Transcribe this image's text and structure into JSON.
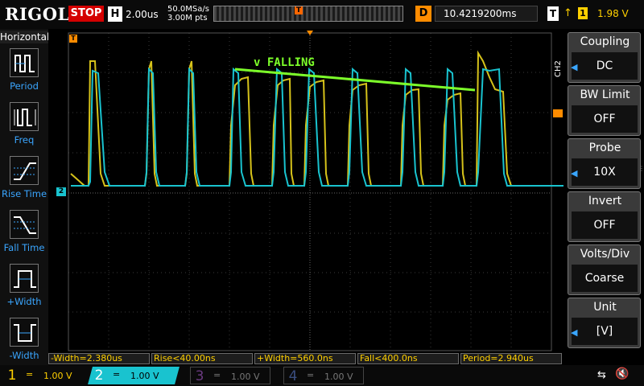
{
  "topbar": {
    "logo": "RIGOL",
    "run_state": "STOP",
    "timebase_label": "H",
    "timebase": "2.00us",
    "sample_rate": "50.0MSa/s",
    "memory_depth": "3.00M pts",
    "trigger_marker": "T",
    "delay_label": "D",
    "delay_value": "10.4219200ms",
    "trigger_label": "T",
    "trigger_edge": "↑",
    "trigger_source": "1",
    "trigger_level": "1.98 V"
  },
  "left_menu": {
    "title": "Horizontal",
    "items": [
      {
        "label": "Period",
        "icon": "period-icon"
      },
      {
        "label": "Freq",
        "icon": "freq-icon"
      },
      {
        "label": "Rise Time",
        "icon": "rise-time-icon"
      },
      {
        "label": "Fall Time",
        "icon": "fall-time-icon"
      },
      {
        "label": "+Width",
        "icon": "pos-width-icon"
      },
      {
        "label": "-Width",
        "icon": "neg-width-icon"
      }
    ]
  },
  "right_menu": {
    "channel_tag": "CH2",
    "items": [
      {
        "title": "Coupling",
        "value": "DC"
      },
      {
        "title": "BW Limit",
        "value": "OFF"
      },
      {
        "title": "Probe",
        "value": "10X"
      },
      {
        "title": "Invert",
        "value": "OFF"
      },
      {
        "title": "Volts/Div",
        "value": "Coarse"
      },
      {
        "title": "Unit",
        "value": "[V]"
      }
    ]
  },
  "screen": {
    "annotation": "v FALLING",
    "ch1_marker": "1",
    "ch2_marker": "2",
    "trigger_pos_marker": "T"
  },
  "measurements": [
    "-Width=2.380us",
    "Rise<40.00ns",
    "+Width=560.0ns",
    "Fall<400.0ns",
    "Period=2.940us"
  ],
  "channels": [
    {
      "num": "1",
      "coupling": "=",
      "scale": "1.00 V",
      "color": "#ffd000",
      "active": true
    },
    {
      "num": "2",
      "coupling": "=",
      "scale": "1.00 V",
      "color": "#19c3cf",
      "active": true
    },
    {
      "num": "3",
      "coupling": "=",
      "scale": "1.00 V",
      "color": "#b14dd6",
      "active": false
    },
    {
      "num": "4",
      "coupling": "=",
      "scale": "1.00 V",
      "color": "#4a7dff",
      "active": false
    }
  ],
  "colors": {
    "ch1": "#d6c21a",
    "ch2": "#19c3cf",
    "annotation": "#7dff2a",
    "menu_accent": "#3aa6ff",
    "stop": "#d40000",
    "orange": "#ff8c00"
  },
  "icons": {
    "usb": "usb-icon",
    "speaker": "speaker-muted-icon"
  }
}
